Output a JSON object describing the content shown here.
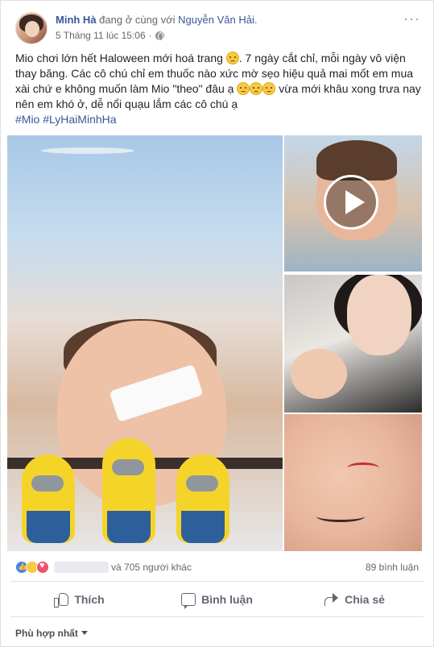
{
  "post": {
    "author": "Minh Hà",
    "with_text": " đang ở cùng với ",
    "tagged": "Nguyễn Văn Hải",
    "tagged_suffix": ".",
    "timestamp": "5 Tháng 11 lúc 15:06",
    "separator": "·",
    "more_menu": "···",
    "text_p1": "Mio chơi lớn hết Haloween mới hoá trang ",
    "text_p2": ". 7 ngày cắt chỉ, mỗi ngày vô viện thay băng. Các cô chú chỉ em thuốc nào xức mờ sẹo hiệu quả mai mốt em mua xài chứ e không muốn làm Mio \"theo\" đâu ạ ",
    "text_p3": " vừa mới khâu xong trưa nay nên em khó ở, dễ nổi quạu lắm các cô chú ạ",
    "hashtags": "#Mio #LyHaiMinhHa"
  },
  "stats": {
    "others_text": "và 705 người khác",
    "comments_text": "89 bình luận"
  },
  "actions": {
    "like": "Thích",
    "comment": "Bình luận",
    "share": "Chia sẻ"
  },
  "comments_sort": {
    "label": "Phù hợp nhất"
  },
  "icons": {
    "globe": "globe-icon",
    "play": "play-icon",
    "like": "thumbs-up-icon",
    "comment": "speech-bubble-icon",
    "share": "share-arrow-icon"
  },
  "colors": {
    "link": "#365899",
    "meta": "#616770",
    "like_reaction": "#4080ff",
    "love_reaction": "#f25268",
    "sad_reaction": "#f7c940"
  }
}
